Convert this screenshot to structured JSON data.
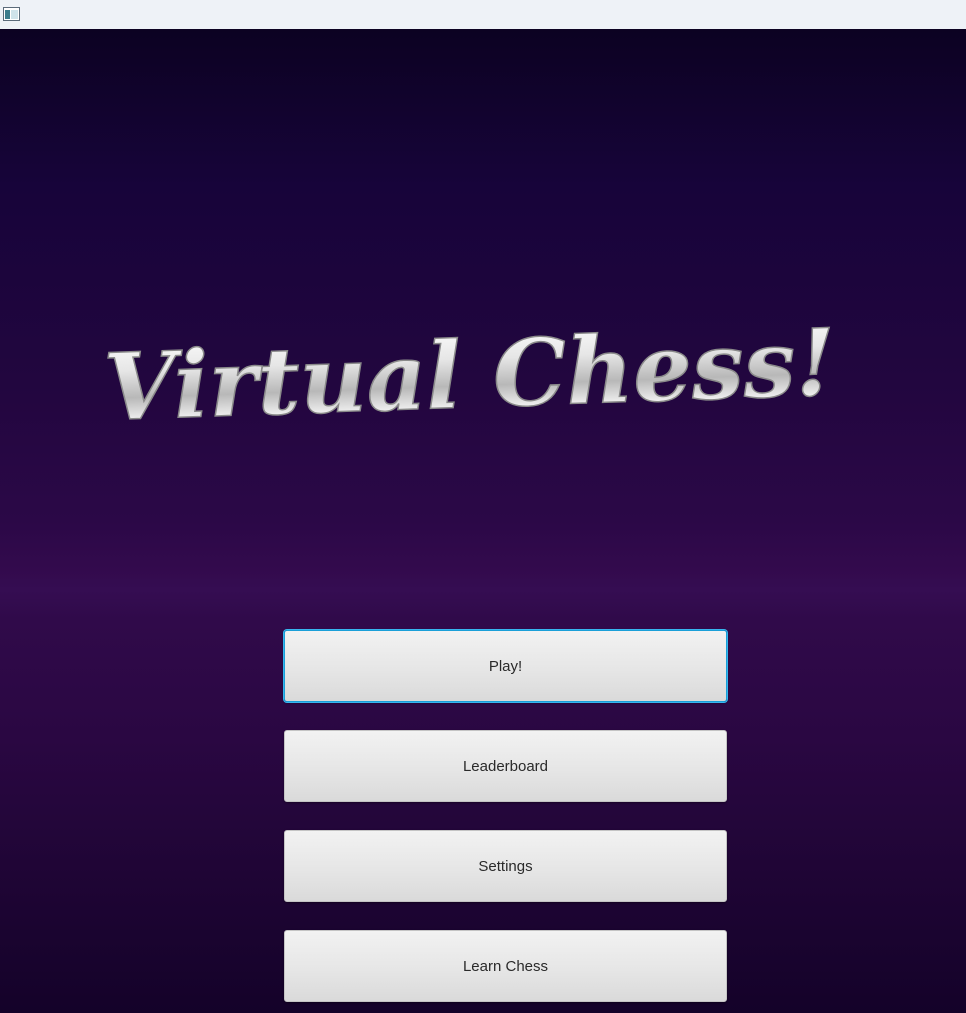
{
  "window": {
    "icon": "app-window-icon"
  },
  "logo": {
    "text": "Virtual Chess!",
    "color": "#d9d9d9"
  },
  "menu": {
    "play_label": "Play!",
    "leaderboard_label": "Leaderboard",
    "settings_label": "Settings",
    "learn_label": "Learn Chess"
  },
  "colors": {
    "focus_ring": "#1a9fd8",
    "background_top": "#0c0222",
    "background_mid": "#330a4d"
  }
}
